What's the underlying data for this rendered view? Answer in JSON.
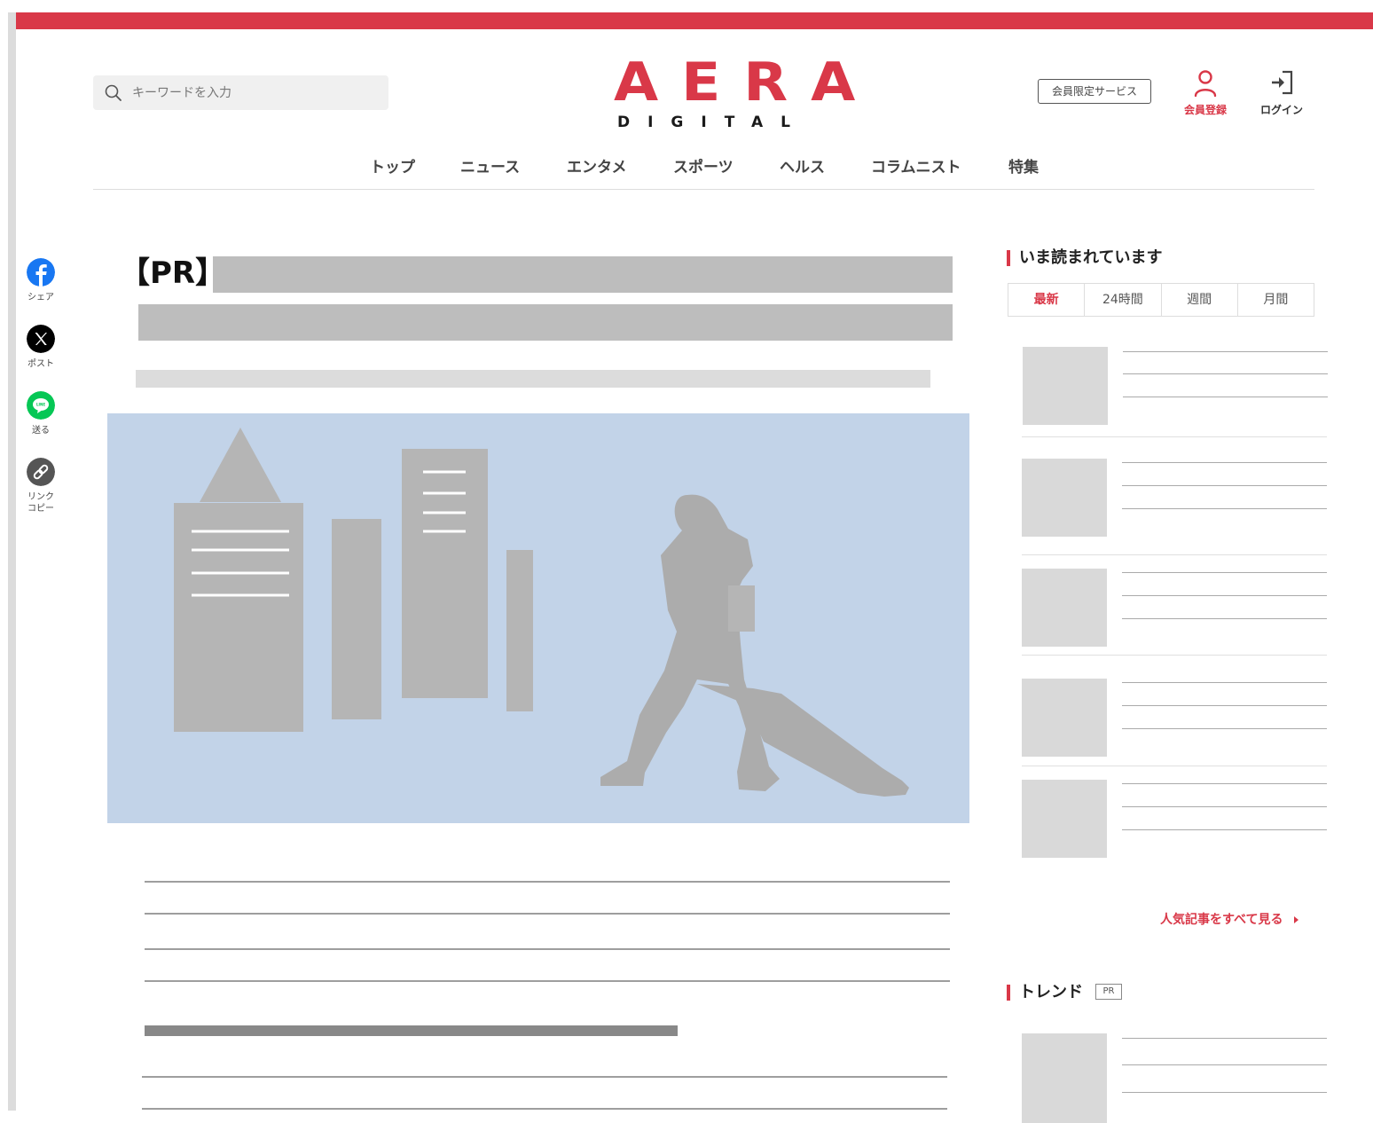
{
  "header": {
    "search": {
      "placeholder": "キーワードを入力",
      "icon": "search-icon"
    },
    "logo": {
      "main": "AERA",
      "sub": "DIGITAL",
      "color": "#d93848"
    },
    "member_service_label": "会員限定サービス",
    "register_label": "会員登録",
    "login_label": "ログイン"
  },
  "nav": {
    "items": [
      {
        "label": "トップ"
      },
      {
        "label": "ニュース"
      },
      {
        "label": "エンタメ"
      },
      {
        "label": "スポーツ"
      },
      {
        "label": "ヘルス"
      },
      {
        "label": "コラムニスト"
      },
      {
        "label": "特集"
      }
    ]
  },
  "share": {
    "items": [
      {
        "icon": "facebook-icon",
        "label": "シェア",
        "color": "#1877f2"
      },
      {
        "icon": "x-icon",
        "label": "ポスト",
        "color": "#000000"
      },
      {
        "icon": "line-icon",
        "label": "送る",
        "color": "#06c755"
      },
      {
        "icon": "link-icon",
        "label": "リンク\nコピー",
        "color": "#555555"
      }
    ]
  },
  "article": {
    "title_prefix": "【PR】"
  },
  "sidebar": {
    "popular": {
      "heading": "いま読まれています",
      "tabs": [
        {
          "label": "最新",
          "active": true
        },
        {
          "label": "24時間",
          "active": false
        },
        {
          "label": "週間",
          "active": false
        },
        {
          "label": "月間",
          "active": false
        }
      ],
      "more_label": "人気記事をすべて見る",
      "more_icon": "caret-right-icon"
    },
    "trend": {
      "heading": "トレンド",
      "badge": "PR"
    }
  },
  "colors": {
    "accent": "#d93848",
    "hero_bg": "#c2d3e8",
    "placeholder": "#bdbdbd"
  }
}
